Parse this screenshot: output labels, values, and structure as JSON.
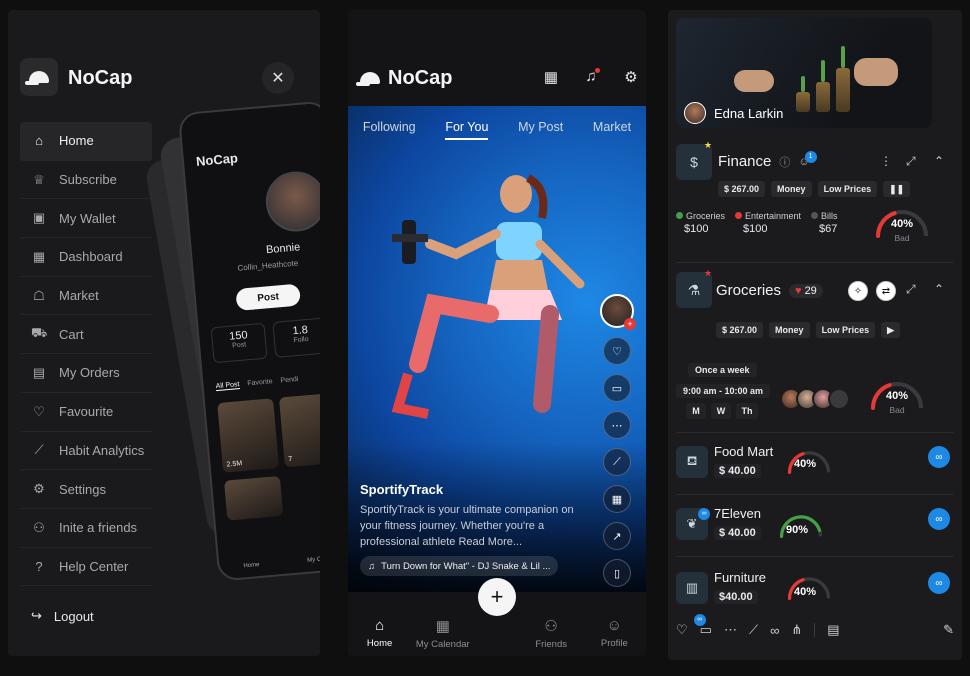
{
  "app": {
    "name": "NoCap"
  },
  "sidebar": {
    "items": [
      {
        "label": "Home",
        "icon": "home-icon",
        "glyph": "⌂",
        "active": true
      },
      {
        "label": "Subscribe",
        "icon": "crown-icon",
        "glyph": "♕"
      },
      {
        "label": "My Wallet",
        "icon": "wallet-icon",
        "glyph": "▣"
      },
      {
        "label": "Dashboard",
        "icon": "dashboard-icon",
        "glyph": "▦"
      },
      {
        "label": "Market",
        "icon": "market-icon",
        "glyph": "☖"
      },
      {
        "label": "Cart",
        "icon": "cart-icon",
        "glyph": "⛟"
      },
      {
        "label": "My Orders",
        "icon": "orders-icon",
        "glyph": "▤"
      },
      {
        "label": "Favourite",
        "icon": "heart-icon",
        "glyph": "♡"
      },
      {
        "label": "Habit Analytics",
        "icon": "analytics-icon",
        "glyph": "⟋"
      },
      {
        "label": "Settings",
        "icon": "gear-icon",
        "glyph": "⚙"
      },
      {
        "label": "Inite a friends",
        "icon": "add-user-icon",
        "glyph": "⚇"
      },
      {
        "label": "Help Center",
        "icon": "help-icon",
        "glyph": "?"
      }
    ],
    "logout": "Logout"
  },
  "phone": {
    "brand": "NoCap",
    "name": "Bonnie",
    "username": "Collin_Heathcote",
    "post_button": "Post",
    "stats": [
      {
        "value": "150",
        "label": "Post"
      },
      {
        "value": "1.8",
        "label": "Follo"
      }
    ],
    "tabs": [
      "All Post",
      "Favorite",
      "Pendi"
    ],
    "thumb_views": [
      "2.5M",
      "7"
    ],
    "nav": [
      "Home",
      "My Calendar"
    ]
  },
  "feed": {
    "tabs": [
      "Following",
      "For You",
      "My Post",
      "Market"
    ],
    "active_tab": "For You",
    "post_title": "SportifyTrack",
    "post_desc": "SportifyTrack is your ultimate companion on your fitness journey. Whether you're a professional athlete Read More...",
    "music": "Turn Down for What\" - DJ Snake & Lil ...",
    "bottom_nav": [
      "Home",
      "My Calendar",
      "Friends",
      "Profile"
    ]
  },
  "dashboard": {
    "banner_user": "Edna Larkin",
    "finance": {
      "title": "Finance",
      "badge": "1",
      "pills": [
        "$ 267.00",
        "Money",
        "Low Prices"
      ],
      "legend": [
        {
          "label": "Groceries",
          "amount": "$100",
          "color": "#43a047"
        },
        {
          "label": "Entertainment",
          "amount": "$100",
          "color": "#e53935"
        },
        {
          "label": "Bills",
          "amount": "$67",
          "color": "#3a3a3d"
        }
      ],
      "gauge": {
        "value": 40,
        "label": "40%",
        "status": "Bad",
        "color": "#e53935"
      }
    },
    "groceries": {
      "title": "Groceries",
      "likes": "29",
      "pills": [
        "$ 267.00",
        "Money",
        "Low Prices"
      ],
      "frequency": "Once a week",
      "time": "9:00 am - 10:00 am",
      "days": [
        "M",
        "W",
        "Th"
      ],
      "gauge": {
        "value": 40,
        "label": "40%",
        "status": "Bad",
        "color": "#e53935"
      }
    },
    "items": [
      {
        "name": "Food Mart",
        "price": "$ 40.00",
        "gauge": {
          "value": 40,
          "label": "40%",
          "color": "#e53935"
        },
        "icon": "bag-icon",
        "glyph": "⛾"
      },
      {
        "name": "7Eleven",
        "price": "$ 40.00",
        "gauge": {
          "value": 90,
          "label": "90%",
          "color": "#43a047"
        },
        "icon": "leaf-icon",
        "glyph": "❦"
      },
      {
        "name": "Furniture",
        "price": "$40.00",
        "gauge": {
          "value": 40,
          "label": "40%",
          "color": "#e53935"
        },
        "icon": "furniture-icon",
        "glyph": "▥"
      }
    ]
  },
  "colors": {
    "accent": "#1e88e5",
    "danger": "#e53935",
    "success": "#43a047"
  }
}
